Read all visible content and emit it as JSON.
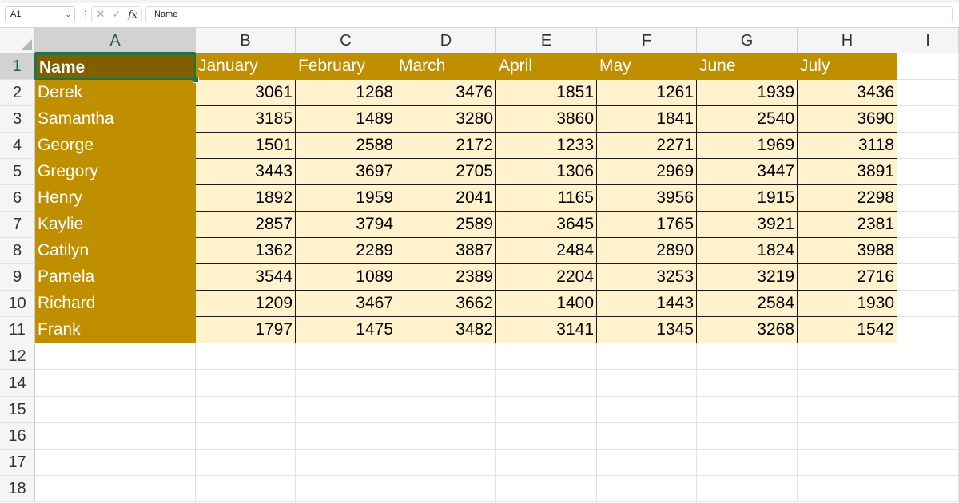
{
  "formula_bar": {
    "name_box": "A1",
    "formula": "Name",
    "cancel_glyph": "✕",
    "enter_glyph": "✓",
    "fx_glyph": "fx",
    "kebab_glyph": "⋮",
    "chevron_glyph": "⌄"
  },
  "columns": [
    "A",
    "B",
    "C",
    "D",
    "E",
    "F",
    "G",
    "H",
    "I"
  ],
  "rows": [
    "1",
    "2",
    "3",
    "4",
    "5",
    "6",
    "7",
    "8",
    "9",
    "10",
    "11",
    "12",
    "14",
    "15",
    "16",
    "17",
    "18"
  ],
  "table": {
    "headers": [
      "Name",
      "January",
      "February",
      "March",
      "April",
      "May",
      "June",
      "July"
    ],
    "data": [
      {
        "name": "Derek",
        "values": [
          "3061",
          "1268",
          "3476",
          "1851",
          "1261",
          "1939",
          "3436"
        ]
      },
      {
        "name": "Samantha",
        "values": [
          "3185",
          "1489",
          "3280",
          "3860",
          "1841",
          "2540",
          "3690"
        ]
      },
      {
        "name": "George",
        "values": [
          "1501",
          "2588",
          "2172",
          "1233",
          "2271",
          "1969",
          "3118"
        ]
      },
      {
        "name": "Gregory",
        "values": [
          "3443",
          "3697",
          "2705",
          "1306",
          "2969",
          "3447",
          "3891"
        ]
      },
      {
        "name": "Henry",
        "values": [
          "1892",
          "1959",
          "2041",
          "1165",
          "3956",
          "1915",
          "2298"
        ]
      },
      {
        "name": "Kaylie",
        "values": [
          "2857",
          "3794",
          "2589",
          "3645",
          "1765",
          "3921",
          "2381"
        ]
      },
      {
        "name": "Catilyn",
        "values": [
          "1362",
          "2289",
          "3887",
          "2484",
          "2890",
          "1824",
          "3988"
        ]
      },
      {
        "name": "Pamela",
        "values": [
          "3544",
          "1089",
          "2389",
          "2204",
          "3253",
          "3219",
          "2716"
        ]
      },
      {
        "name": "Richard",
        "values": [
          "1209",
          "3467",
          "3662",
          "1400",
          "1443",
          "2584",
          "1930"
        ]
      },
      {
        "name": "Frank",
        "values": [
          "1797",
          "1475",
          "3482",
          "3141",
          "1345",
          "3268",
          "1542"
        ]
      }
    ]
  },
  "colors": {
    "header_fill": "#bf8f00",
    "name_fill": "#bf8f00",
    "active_cell_fill": "#7f6000",
    "value_fill": "#fff2cc",
    "selection_accent": "#217346"
  }
}
